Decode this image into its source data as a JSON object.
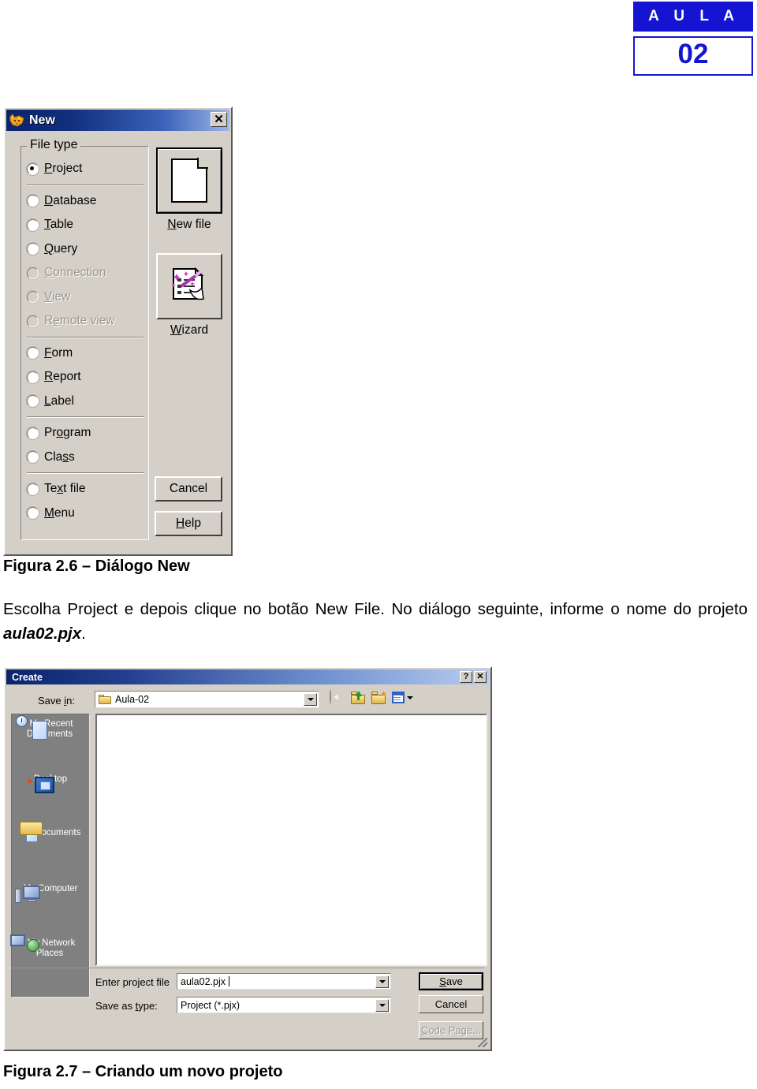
{
  "badge": {
    "lesson_word": "A U L A",
    "lesson_number": "02"
  },
  "new_dialog": {
    "title": "New",
    "icon": "foxpro-fox-icon",
    "close_label": "✕",
    "group_label": "File type",
    "file_types": [
      {
        "label_pre": "",
        "accel": "P",
        "label_post": "roject",
        "checked": true,
        "disabled": false
      },
      {
        "label_pre": "",
        "accel": "D",
        "label_post": "atabase",
        "checked": false,
        "disabled": false
      },
      {
        "label_pre": "",
        "accel": "T",
        "label_post": "able",
        "checked": false,
        "disabled": false
      },
      {
        "label_pre": "",
        "accel": "Q",
        "label_post": "uery",
        "checked": false,
        "disabled": false
      },
      {
        "label_pre": "",
        "accel": "C",
        "label_post": "onnection",
        "checked": false,
        "disabled": true
      },
      {
        "label_pre": "",
        "accel": "V",
        "label_post": "iew",
        "checked": false,
        "disabled": true
      },
      {
        "label_pre": "R",
        "accel": "e",
        "label_post": "mote view",
        "checked": false,
        "disabled": true
      },
      {
        "label_pre": "",
        "accel": "F",
        "label_post": "orm",
        "checked": false,
        "disabled": false
      },
      {
        "label_pre": "",
        "accel": "R",
        "label_post": "eport",
        "checked": false,
        "disabled": false
      },
      {
        "label_pre": "",
        "accel": "L",
        "label_post": "abel",
        "checked": false,
        "disabled": false
      },
      {
        "label_pre": "Pr",
        "accel": "o",
        "label_post": "gram",
        "checked": false,
        "disabled": false
      },
      {
        "label_pre": "Cla",
        "accel": "s",
        "label_post": "s",
        "checked": false,
        "disabled": false
      },
      {
        "label_pre": "Te",
        "accel": "x",
        "label_post": "t file",
        "checked": false,
        "disabled": false
      },
      {
        "label_pre": "",
        "accel": "M",
        "label_post": "enu",
        "checked": false,
        "disabled": false
      }
    ],
    "newfile_caption_accel": "N",
    "newfile_caption_rest": "ew file",
    "newfile_icon": "blank-page-icon",
    "wizard_caption_accel": "W",
    "wizard_caption_rest": "izard",
    "wizard_icon": "magic-wand-document-icon",
    "cancel_label": "Cancel",
    "help_accel": "H",
    "help_rest": "elp"
  },
  "figure_26": "Figura 2.6 – Diálogo New",
  "body_text": {
    "part1": "Escolha Project e depois clique no botão New File. No diálogo seguinte, informe o nome do projeto ",
    "bold": "aula02.pjx",
    "part2": "."
  },
  "create_dialog": {
    "title": "Create",
    "help_btn": "?",
    "close_btn": "✕",
    "savein_label_pre": "Save ",
    "savein_label_accel": "i",
    "savein_label_post": "n:",
    "savein_value": "Aula-02",
    "savein_icon": "folder-icon",
    "nav_icons": [
      {
        "name": "back-icon",
        "disabled": true
      },
      {
        "name": "up-one-level-icon",
        "disabled": false
      },
      {
        "name": "new-folder-icon",
        "disabled": false
      },
      {
        "name": "views-dropdown-icon",
        "disabled": false
      }
    ],
    "places": [
      {
        "label": "My Recent\nDocuments",
        "icon": "recent-documents-icon"
      },
      {
        "label": "Desktop",
        "icon": "desktop-icon"
      },
      {
        "label": "My Documents",
        "icon": "my-documents-icon"
      },
      {
        "label": "My Computer",
        "icon": "my-computer-icon"
      },
      {
        "label": "My Network\nPlaces",
        "icon": "network-places-icon"
      }
    ],
    "file_list_items": [],
    "project_label": "Enter project file",
    "project_value": "aula02.pjx",
    "savetype_label_pre": "Save as ",
    "savetype_label_accel": "t",
    "savetype_label_post": "ype:",
    "savetype_value": "Project (*.pjx)",
    "save_accel": "S",
    "save_rest": "ave",
    "cancel_label": "Cancel",
    "codepage_accel": "C",
    "codepage_rest": "ode Page...",
    "codepage_disabled": true
  },
  "figure_27": "Figura 2.7 – Criando um novo projeto",
  "colors": {
    "brand_blue": "#1414d2",
    "window_face": "#d4d0c8",
    "titlebar_dark": "#0a246a",
    "places_bar": "#808080",
    "disabled_text": "#9a968e"
  }
}
